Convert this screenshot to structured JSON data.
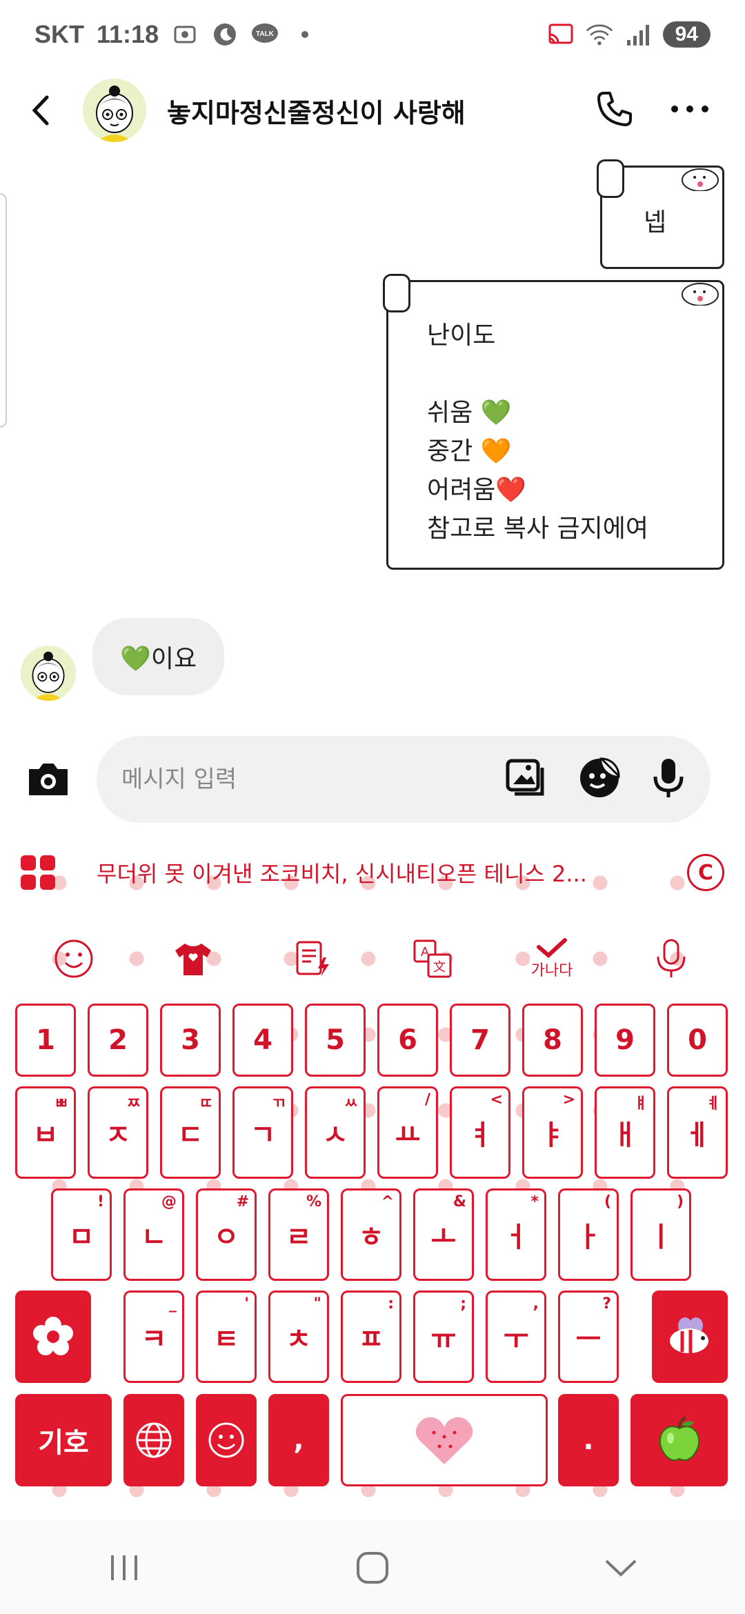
{
  "status_bar": {
    "carrier": "SKT",
    "time": "11:18",
    "battery": "94",
    "icons": [
      "screen-record-icon",
      "moon-icon",
      "talk-icon",
      "dot-icon",
      "cast-icon",
      "wifi-icon",
      "signal-icon"
    ]
  },
  "header": {
    "title": "놓지마정신줄정신이 사랑해",
    "icons": [
      "back-icon",
      "phone-icon",
      "more-icon"
    ]
  },
  "messages": {
    "sent": [
      {
        "text": "넵"
      },
      {
        "line1": "난이도",
        "line2": "",
        "line3": "쉬움 💚",
        "line4": "중간 🧡",
        "line5": "어려움❤️",
        "line6": "참고로 복사 금지에여"
      }
    ],
    "received": [
      {
        "text": "💚이요"
      }
    ]
  },
  "input": {
    "placeholder": "메시지 입력"
  },
  "keyboard": {
    "suggestion": "무더위 못 이겨낸 조코비치, 신시내티오픈 테니스 2...",
    "copyright": "C",
    "tools": [
      "emoji-icon",
      "shirt-icon",
      "text-edit-icon",
      "translate-icon",
      "spellcheck-icon",
      "mic-icon"
    ],
    "spellcheck_label": "가나다",
    "row_numbers": [
      "1",
      "2",
      "3",
      "4",
      "5",
      "6",
      "7",
      "8",
      "9",
      "0"
    ],
    "row1": [
      {
        "main": "ㅂ",
        "sub": "ㅃ"
      },
      {
        "main": "ㅈ",
        "sub": "ㅉ"
      },
      {
        "main": "ㄷ",
        "sub": "ㄸ"
      },
      {
        "main": "ㄱ",
        "sub": "ㄲ"
      },
      {
        "main": "ㅅ",
        "sub": "ㅆ"
      },
      {
        "main": "ㅛ",
        "sub": "/"
      },
      {
        "main": "ㅕ",
        "sub": "<"
      },
      {
        "main": "ㅑ",
        "sub": ">"
      },
      {
        "main": "ㅐ",
        "sub": "ㅒ"
      },
      {
        "main": "ㅔ",
        "sub": "ㅖ"
      }
    ],
    "row2": [
      {
        "main": "ㅁ",
        "sub": "!"
      },
      {
        "main": "ㄴ",
        "sub": "@"
      },
      {
        "main": "ㅇ",
        "sub": "#"
      },
      {
        "main": "ㄹ",
        "sub": "%"
      },
      {
        "main": "ㅎ",
        "sub": "^"
      },
      {
        "main": "ㅗ",
        "sub": "&"
      },
      {
        "main": "ㅓ",
        "sub": "*"
      },
      {
        "main": "ㅏ",
        "sub": "("
      },
      {
        "main": "ㅣ",
        "sub": ")"
      }
    ],
    "row3": [
      {
        "main": "ㅋ",
        "sub": "_"
      },
      {
        "main": "ㅌ",
        "sub": "'"
      },
      {
        "main": "ㅊ",
        "sub": "\""
      },
      {
        "main": "ㅍ",
        "sub": ":"
      },
      {
        "main": "ㅠ",
        "sub": ";"
      },
      {
        "main": "ㅜ",
        "sub": ","
      },
      {
        "main": "ㅡ",
        "sub": "?"
      }
    ],
    "symbols_label": "기호",
    "comma": ",",
    "period": "."
  },
  "nav": [
    "recents-icon",
    "home-icon",
    "back-chevron-icon"
  ],
  "colors": {
    "accent": "#e0192e",
    "bubble_received": "#efefef"
  }
}
